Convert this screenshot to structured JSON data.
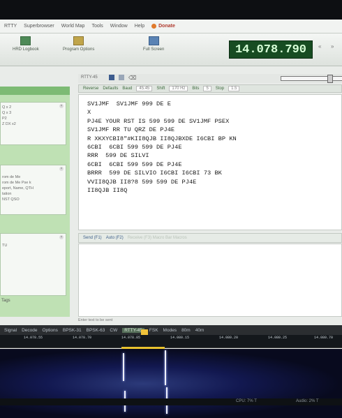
{
  "menu": {
    "items": [
      "RTTY",
      "Superbrowser",
      "World Map",
      "Tools",
      "Window",
      "Help"
    ],
    "donate": "Donate"
  },
  "toolbar": {
    "buttons": [
      "HRD Logbook",
      "Program Options",
      "Full Screen"
    ],
    "frequency": "14.078.790"
  },
  "mode_bar": {
    "mode": "RTTY-45",
    "reverse": "Reverse",
    "defaults": "Defaults",
    "baud_label": "Baud",
    "baud": "45.45",
    "shift_label": "Shift",
    "shift": "170 Hz",
    "bits_label": "Bits",
    "bits": "5",
    "stop_label": "Stop",
    "stop": "1.5"
  },
  "rx_lines": [
    "SV1JMF  SV1JMF 999 DE E",
    "X",
    "PJ4E YOUR RST IS 599 599 DE SV1JMF PSEX",
    "SV1JMF RR TU QRZ DE PJ4E",
    "R XKXYCBI8\"#KII8QJB II8QJBXDE I6CBI BP KN",
    "6CBI  6CBI 599 599 DE PJ4E",
    "RRR  599 DE SILVI",
    "6CBI  6CBI 599 599 DE PJ4E",
    "BRRR  599 DE SILVIO I6CBI I6CBI 73 BK",
    "VVII8QJB II8?8 599 599 DE PJ4E",
    "II8QJB II8Q"
  ],
  "send_bar": {
    "send": "Send (F1)",
    "auto": "Auto (F2)",
    "faded": "Receive (F3)   Macro Bar   Macros"
  },
  "tx_placeholder": "Enter text to be sent",
  "left_panel": {
    "section1": [
      "Q x 2",
      "Q x 3",
      "P2",
      "Z DX x2"
    ],
    "section2": [
      "rom de Me",
      "rom de Me Pse k",
      "eport, Name, QTH",
      "tation",
      "NST QSO"
    ],
    "section3": [
      "TU"
    ],
    "tags": "Tags"
  },
  "bottom_bar": {
    "signal": "Signal",
    "highlight_mode": "RTTY-45",
    "items": [
      "Decode",
      "Options",
      "BPSK-31",
      "BPSK-63",
      "CW"
    ],
    "tail": [
      "FSK",
      "Modes",
      "80m",
      "40m"
    ]
  },
  "scale_ticks": [
    "14.078.55",
    "14.078.70",
    "14.078.85",
    "14.080.15",
    "14.080.20",
    "14.080.25",
    "14.080.70"
  ],
  "status": {
    "cpu": "CPU: 7% T",
    "audio": "Audio: 2% T"
  }
}
